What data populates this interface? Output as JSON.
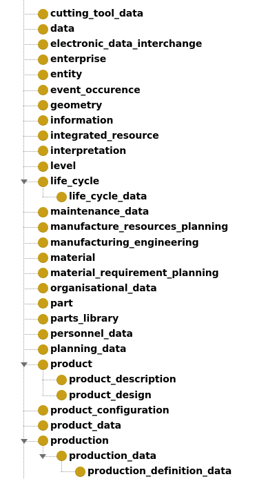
{
  "tree": {
    "nodes": [
      {
        "label": "cutting_tool_data",
        "depth": 0
      },
      {
        "label": "data",
        "depth": 0
      },
      {
        "label": "electronic_data_interchange",
        "depth": 0
      },
      {
        "label": "enterprise",
        "depth": 0
      },
      {
        "label": "entity",
        "depth": 0
      },
      {
        "label": "event_occurence",
        "depth": 0
      },
      {
        "label": "geometry",
        "depth": 0
      },
      {
        "label": "information",
        "depth": 0
      },
      {
        "label": "integrated_resource",
        "depth": 0
      },
      {
        "label": "interpretation",
        "depth": 0
      },
      {
        "label": "level",
        "depth": 0
      },
      {
        "label": "life_cycle",
        "depth": 0,
        "expanded": true
      },
      {
        "label": "life_cycle_data",
        "depth": 1
      },
      {
        "label": "maintenance_data",
        "depth": 0
      },
      {
        "label": "manufacture_resources_planning",
        "depth": 0
      },
      {
        "label": "manufacturing_engineering",
        "depth": 0
      },
      {
        "label": "material",
        "depth": 0
      },
      {
        "label": "material_requirement_planning",
        "depth": 0
      },
      {
        "label": "organisational_data",
        "depth": 0
      },
      {
        "label": "part",
        "depth": 0
      },
      {
        "label": "parts_library",
        "depth": 0
      },
      {
        "label": "personnel_data",
        "depth": 0
      },
      {
        "label": "planning_data",
        "depth": 0
      },
      {
        "label": "product",
        "depth": 0,
        "expanded": true
      },
      {
        "label": "product_description",
        "depth": 1
      },
      {
        "label": "product_design",
        "depth": 1
      },
      {
        "label": "product_configuration",
        "depth": 0
      },
      {
        "label": "product_data",
        "depth": 0
      },
      {
        "label": "production",
        "depth": 0,
        "expanded": true
      },
      {
        "label": "production_data",
        "depth": 1,
        "expanded": true
      },
      {
        "label": "production_definition_data",
        "depth": 2
      }
    ],
    "node_icon_color": "#c79e16",
    "guide_color": "#9a9a9a",
    "expander_color": "#6f6f6f",
    "node_icon": "class-circle-icon",
    "expander_icon": "expanded-triangle-icon"
  }
}
